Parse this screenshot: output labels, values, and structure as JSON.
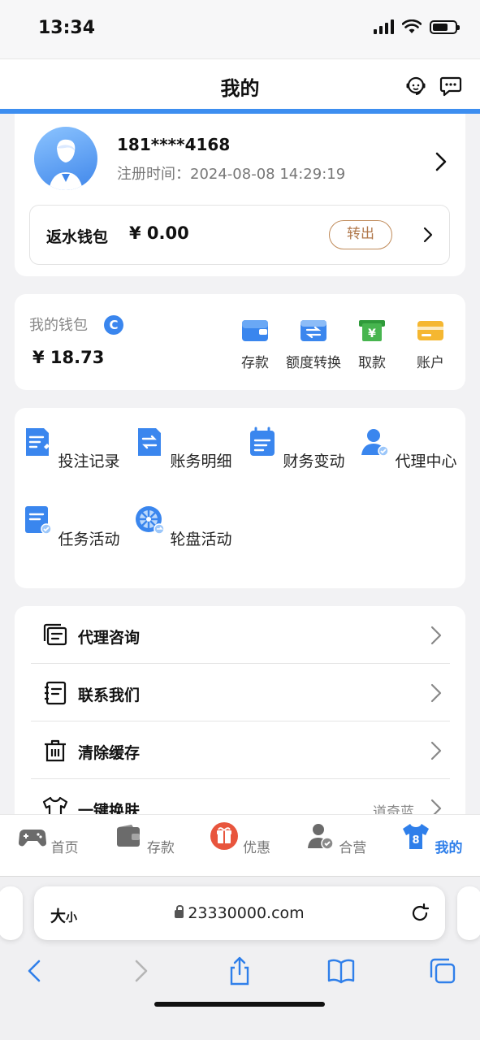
{
  "status": {
    "time": "13:34"
  },
  "header": {
    "title": "我的",
    "icons": [
      "support-headset-icon",
      "chat-bubble-icon"
    ]
  },
  "profile": {
    "phone": "181****4168",
    "reg_label": "注册时间：",
    "reg_time": "2024-08-08 14:29:19",
    "rebate_wallet": {
      "label": "返水钱包",
      "amount": "¥ 0.00",
      "button": "转出"
    }
  },
  "wallet": {
    "label": "我的钱包",
    "balance": "¥  18.73",
    "actions": [
      {
        "label": "存款",
        "icon": "deposit-wallet-icon"
      },
      {
        "label": "额度转换",
        "icon": "transfer-icon"
      },
      {
        "label": "取款",
        "icon": "withdraw-icon"
      },
      {
        "label": "账户",
        "icon": "account-card-icon"
      }
    ]
  },
  "grid": [
    {
      "label": "投注记录",
      "icon": "bet-record-icon"
    },
    {
      "label": "账务明细",
      "icon": "account-detail-icon"
    },
    {
      "label": "财务变动",
      "icon": "finance-change-icon"
    },
    {
      "label": "代理中心",
      "icon": "agent-center-icon"
    },
    {
      "label": "任务活动",
      "icon": "task-activity-icon"
    },
    {
      "label": "轮盘活动",
      "icon": "roulette-icon"
    }
  ],
  "menu": [
    {
      "label": "代理咨询",
      "icon": "agent-consult-icon",
      "value": ""
    },
    {
      "label": "联系我们",
      "icon": "contact-icon",
      "value": ""
    },
    {
      "label": "清除缓存",
      "icon": "trash-icon",
      "value": ""
    },
    {
      "label": "一键换肤",
      "icon": "shirt-icon",
      "value": "道奇蓝"
    }
  ],
  "tabs": [
    {
      "label": "首页",
      "icon": "gamepad-icon",
      "active": false
    },
    {
      "label": "存款",
      "icon": "wallet-icon",
      "active": false
    },
    {
      "label": "优惠",
      "icon": "gift-icon",
      "active": false
    },
    {
      "label": "合营",
      "icon": "partner-icon",
      "active": false
    },
    {
      "label": "我的",
      "icon": "jersey-icon",
      "active": true
    }
  ],
  "browser": {
    "text_size": "大",
    "text_size_small": "小",
    "url": "23330000.com"
  },
  "colors": {
    "accent": "#3d8ef0",
    "active_tab": "#2f7fea",
    "rebate_button": "#b0774a"
  }
}
